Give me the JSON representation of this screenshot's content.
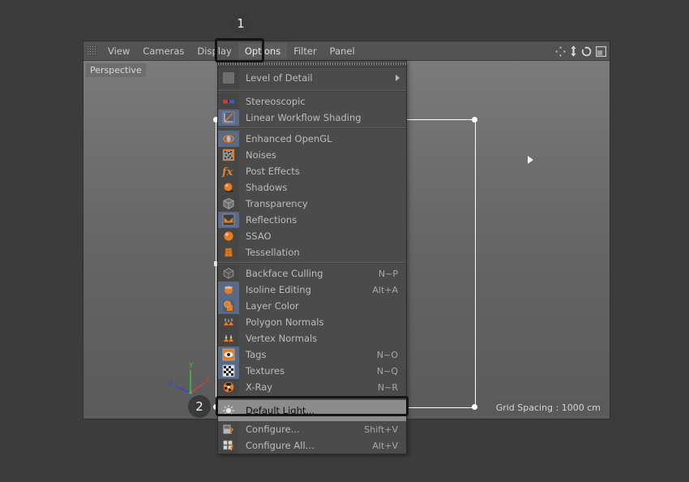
{
  "app": {
    "viewport_name": "Perspective",
    "grid_spacing": "Grid Spacing : 1000 cm"
  },
  "menubar": {
    "grip_icon": "grip-dots-icon",
    "items": [
      {
        "label": "View",
        "active": false
      },
      {
        "label": "Cameras",
        "active": false
      },
      {
        "label": "Display",
        "active": false
      },
      {
        "label": "Options",
        "active": true
      },
      {
        "label": "Filter",
        "active": false
      },
      {
        "label": "Panel",
        "active": false
      }
    ],
    "nav_icons": [
      {
        "name": "pan-icon"
      },
      {
        "name": "dolly-icon"
      },
      {
        "name": "rotate-icon"
      },
      {
        "name": "maximize-viewport-icon"
      }
    ]
  },
  "options_menu": {
    "tearoff_name": "tearoff-strip",
    "groups": [
      {
        "items": [
          {
            "label": "Level of Detail",
            "shortcut": "",
            "icon": "level-of-detail-icon",
            "submenu": true,
            "big": true
          }
        ]
      },
      {
        "items": [
          {
            "label": "Stereoscopic",
            "shortcut": "",
            "icon": "stereoscopic-icon"
          },
          {
            "label": "Linear Workflow Shading",
            "shortcut": "",
            "icon": "linear-workflow-icon"
          }
        ]
      },
      {
        "items": [
          {
            "label": "Enhanced OpenGL",
            "shortcut": "",
            "icon": "enhanced-opengl-icon"
          },
          {
            "label": "Noises",
            "shortcut": "",
            "icon": "noises-icon"
          },
          {
            "label": "Post Effects",
            "shortcut": "",
            "icon": "post-effects-icon"
          },
          {
            "label": "Shadows",
            "shortcut": "",
            "icon": "shadows-icon"
          },
          {
            "label": "Transparency",
            "shortcut": "",
            "icon": "transparency-icon"
          },
          {
            "label": "Reflections",
            "shortcut": "",
            "icon": "reflections-icon"
          },
          {
            "label": "SSAO",
            "shortcut": "",
            "icon": "ssao-icon"
          },
          {
            "label": "Tessellation",
            "shortcut": "",
            "icon": "tessellation-icon"
          }
        ]
      },
      {
        "items": [
          {
            "label": "Backface Culling",
            "shortcut": "N~P",
            "icon": "backface-culling-icon"
          },
          {
            "label": "Isoline Editing",
            "shortcut": "Alt+A",
            "icon": "isoline-editing-icon"
          },
          {
            "label": "Layer Color",
            "shortcut": "",
            "icon": "layer-color-icon"
          },
          {
            "label": "Polygon Normals",
            "shortcut": "",
            "icon": "polygon-normals-icon"
          },
          {
            "label": "Vertex Normals",
            "shortcut": "",
            "icon": "vertex-normals-icon"
          },
          {
            "label": "Tags",
            "shortcut": "N~O",
            "icon": "tags-icon"
          },
          {
            "label": "Textures",
            "shortcut": "N~Q",
            "icon": "textures-icon"
          },
          {
            "label": "X-Ray",
            "shortcut": "N~R",
            "icon": "xray-icon"
          }
        ]
      },
      {
        "items": [
          {
            "label": "Default Light...",
            "shortcut": "",
            "icon": "default-light-icon",
            "highlighted": true
          },
          {
            "label": "Configure...",
            "shortcut": "Shift+V",
            "icon": "configure-icon"
          },
          {
            "label": "Configure All...",
            "shortcut": "Alt+V",
            "icon": "configure-all-icon"
          }
        ]
      }
    ]
  },
  "annotations": {
    "badge_1": "1",
    "badge_2": "2"
  },
  "colors": {
    "accent_orange": "#e87d1e",
    "axis_x": "#d43f3f",
    "axis_y": "#3fbf3f",
    "axis_z": "#4040d8",
    "menu_bg": "#4b4b4b",
    "highlight_bg": "#8c8c8c",
    "annotation_ring": "#141414"
  },
  "axis_gizmo": {
    "x_label": "X",
    "y_label": "Y",
    "z_label": "Z"
  }
}
